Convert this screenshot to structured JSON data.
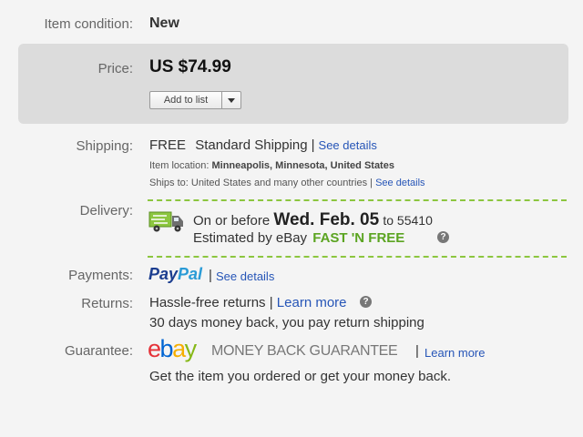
{
  "condition": {
    "label": "Item condition:",
    "value": "New"
  },
  "price": {
    "label": "Price:",
    "value": "US $74.99",
    "add_to_list_label": "Add to list"
  },
  "shipping": {
    "label": "Shipping:",
    "free": "FREE",
    "method": "Standard Shipping",
    "separator": "|",
    "details_link": "See details",
    "location_label": "Item location:",
    "location_value": "Minneapolis, Minnesota, United States",
    "ships_to_label": "Ships to:",
    "ships_to_value": "United States and many other countries",
    "ships_to_separator": "|",
    "ships_to_link": "See details"
  },
  "delivery": {
    "label": "Delivery:",
    "prefix": "On or before",
    "date": "Wed. Feb. 05",
    "to": "to 55410",
    "estimated": "Estimated by eBay",
    "badge": "FAST 'N FREE",
    "help": "?"
  },
  "payments": {
    "label": "Payments:",
    "logo_pay": "Pay",
    "logo_pal": "Pal",
    "separator": "|",
    "details_link": "See details"
  },
  "returns": {
    "label": "Returns:",
    "line1": "Hassle-free returns",
    "separator": "|",
    "learn_more": "Learn more",
    "help": "?",
    "line2": "30 days money back, you pay return shipping"
  },
  "guarantee": {
    "label": "Guarantee:",
    "logo_e": "e",
    "logo_b": "b",
    "logo_a": "a",
    "logo_y": "y",
    "badge": "MONEY BACK GUARANTEE",
    "separator": "|",
    "learn_more": "Learn more",
    "line2": "Get the item you ordered or get your money back."
  },
  "colors": {
    "link": "#2655b7",
    "fast_n_free": "#5ba421",
    "panel": "#dcdcdc",
    "dash": "#8cc63f"
  },
  "icons": {
    "truck": "truck-icon",
    "help": "help-icon",
    "dropdown": "chevron-down-icon"
  }
}
